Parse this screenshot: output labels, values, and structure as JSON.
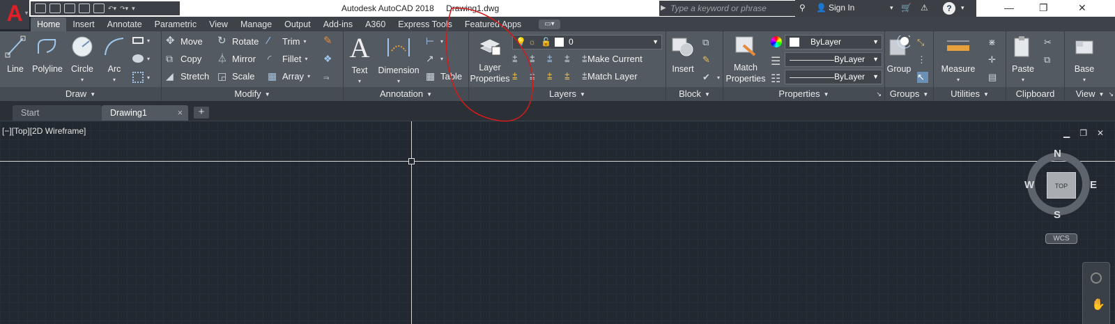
{
  "app": {
    "logo": "A",
    "title": "Autodesk AutoCAD 2018",
    "filename": "Drawing1.dwg"
  },
  "search": {
    "placeholder": "Type a keyword or phrase"
  },
  "account": {
    "sign_in": "Sign In"
  },
  "tabs": [
    "Home",
    "Insert",
    "Annotate",
    "Parametric",
    "View",
    "Manage",
    "Output",
    "Add-ins",
    "A360",
    "Express Tools",
    "Featured Apps"
  ],
  "ribbon": {
    "draw": {
      "title": "Draw",
      "line": "Line",
      "polyline": "Polyline",
      "circle": "Circle",
      "arc": "Arc"
    },
    "modify": {
      "title": "Modify",
      "move": "Move",
      "rotate": "Rotate",
      "trim": "Trim",
      "copy": "Copy",
      "mirror": "Mirror",
      "fillet": "Fillet",
      "stretch": "Stretch",
      "scale": "Scale",
      "array": "Array"
    },
    "annotation": {
      "title": "Annotation",
      "text": "Text",
      "dimension": "Dimension",
      "table": "Table"
    },
    "layers": {
      "title": "Layers",
      "layer_properties_1": "Layer",
      "layer_properties_2": "Properties",
      "current_layer": "0",
      "make_current": "Make Current",
      "match_layer": "Match Layer"
    },
    "block": {
      "title": "Block",
      "insert": "Insert"
    },
    "properties": {
      "title": "Properties",
      "match_1": "Match",
      "match_2": "Properties",
      "color": "ByLayer",
      "linetype": "ByLayer",
      "lineweight": "ByLayer"
    },
    "groups": {
      "title": "Groups",
      "group": "Group"
    },
    "utilities": {
      "title": "Utilities",
      "measure": "Measure"
    },
    "clipboard": {
      "title": "Clipboard",
      "paste": "Paste"
    },
    "view": {
      "title": "View",
      "base": "Base"
    }
  },
  "file_tabs": {
    "start": "Start",
    "drawing": "Drawing1",
    "close": "×",
    "add": "+"
  },
  "viewport": {
    "label": "[−][Top][2D Wireframe]"
  },
  "viewcube": {
    "top": "TOP",
    "n": "N",
    "s": "S",
    "e": "E",
    "w": "W",
    "wcs": "WCS"
  },
  "colors": {
    "annotation_red": "#d41a1a",
    "ribbon_bg": "#535a61",
    "viewport_bg": "#212830"
  }
}
